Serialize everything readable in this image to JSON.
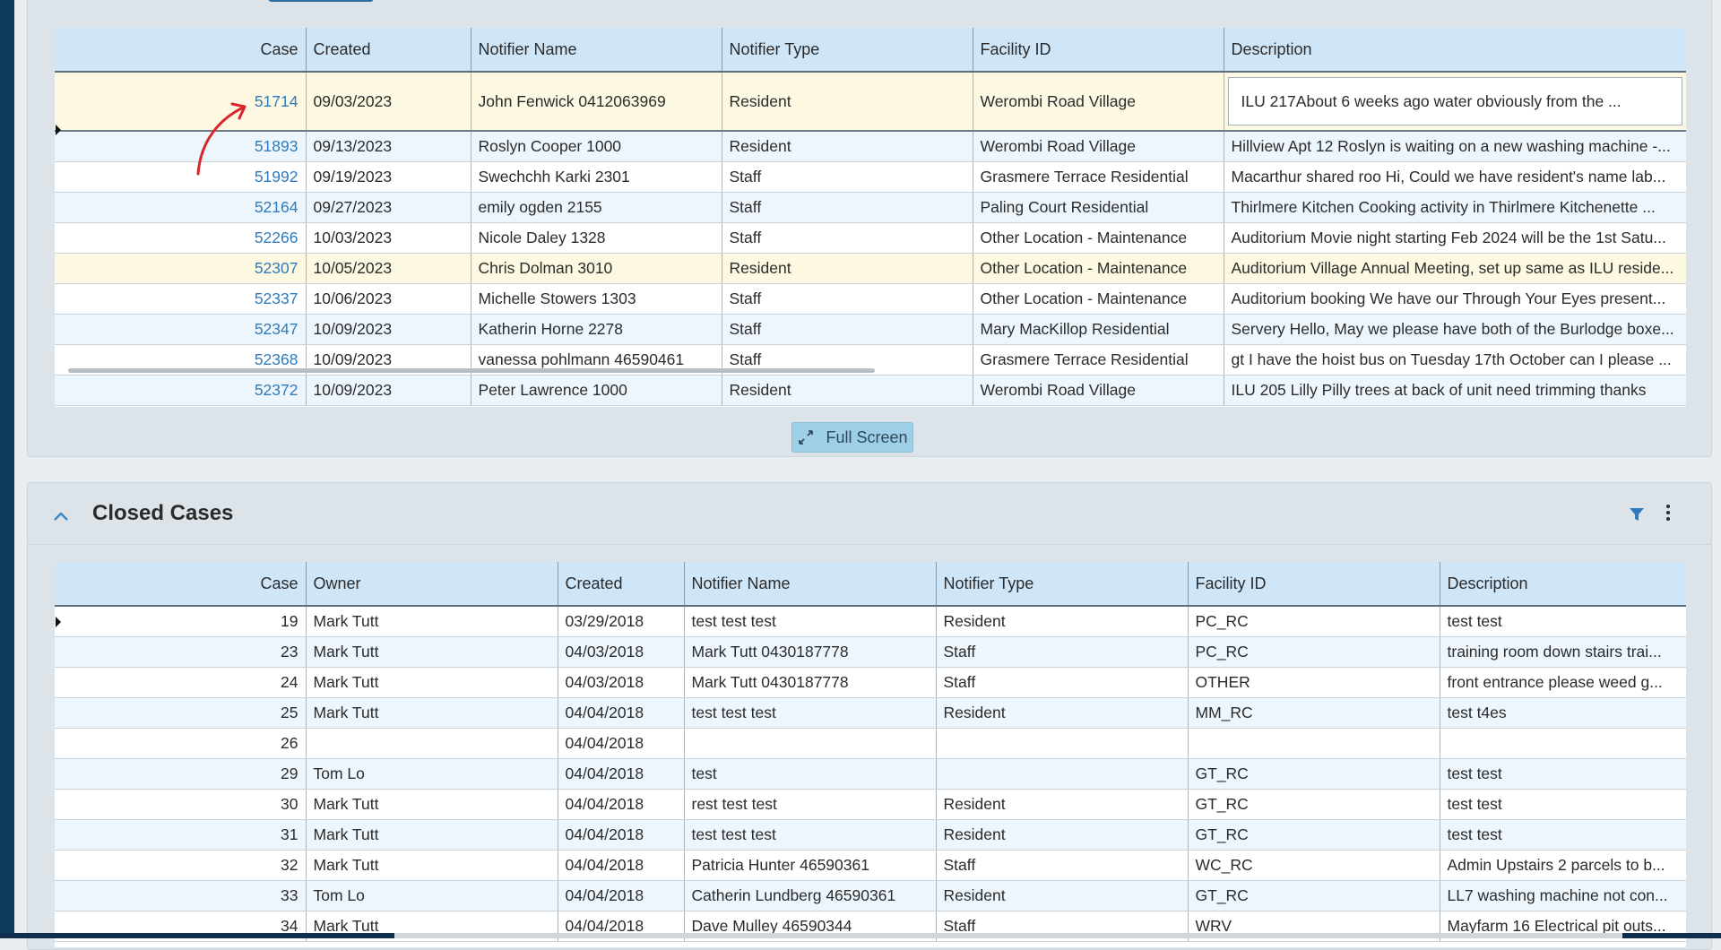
{
  "open_cases": {
    "columns": [
      "Case",
      "Created",
      "Notifier Name",
      "Notifier Type",
      "Facility ID",
      "Description"
    ],
    "rows": [
      {
        "case": "51714",
        "created": "09/03/2023",
        "notifier_name": "John Fenwick 0412063969",
        "notifier_type": "Resident",
        "facility": "Werombi Road Village",
        "description": "ILU 217About 6 weeks ago water obviously from the ..."
      },
      {
        "case": "51893",
        "created": "09/13/2023",
        "notifier_name": "Roslyn Cooper 1000",
        "notifier_type": "Resident",
        "facility": "Werombi Road Village",
        "description": "Hillview Apt 12 Roslyn is waiting on a new washing machine -..."
      },
      {
        "case": "51992",
        "created": "09/19/2023",
        "notifier_name": "Swechchh Karki 2301",
        "notifier_type": "Staff",
        "facility": "Grasmere Terrace Residential",
        "description": "Macarthur shared roo Hi, Could we have resident's name lab..."
      },
      {
        "case": "52164",
        "created": "09/27/2023",
        "notifier_name": "emily ogden 2155",
        "notifier_type": "Staff",
        "facility": "Paling Court Residential",
        "description": "Thirlmere Kitchen Cooking activity in Thirlmere Kitchenette ..."
      },
      {
        "case": "52266",
        "created": "10/03/2023",
        "notifier_name": "Nicole Daley 1328",
        "notifier_type": "Staff",
        "facility": "Other Location - Maintenance",
        "description": "Auditorium Movie night starting Feb 2024 will be the 1st Satu..."
      },
      {
        "case": "52307",
        "created": "10/05/2023",
        "notifier_name": "Chris Dolman 3010",
        "notifier_type": "Resident",
        "facility": "Other Location - Maintenance",
        "description": "Auditorium Village Annual Meeting, set up same as ILU reside..."
      },
      {
        "case": "52337",
        "created": "10/06/2023",
        "notifier_name": "Michelle Stowers 1303",
        "notifier_type": "Staff",
        "facility": "Other Location - Maintenance",
        "description": "Auditorium booking We have our Through Your Eyes present..."
      },
      {
        "case": "52347",
        "created": "10/09/2023",
        "notifier_name": "Katherin Horne 2278",
        "notifier_type": "Staff",
        "facility": "Mary MacKillop Residential",
        "description": "Servery Hello, May we please have both of the Burlodge boxe..."
      },
      {
        "case": "52368",
        "created": "10/09/2023",
        "notifier_name": "vanessa pohlmann 46590461",
        "notifier_type": "Staff",
        "facility": "Grasmere Terrace Residential",
        "description": "gt I have the hoist bus on Tuesday 17th October can I please ..."
      },
      {
        "case": "52372",
        "created": "10/09/2023",
        "notifier_name": "Peter Lawrence 1000",
        "notifier_type": "Resident",
        "facility": "Werombi Road Village",
        "description": "ILU 205 Lilly Pilly trees at back of unit need trimming thanks"
      }
    ]
  },
  "fullscreen_label": "Full Screen",
  "closed_cases": {
    "title": "Closed Cases",
    "columns": [
      "Case",
      "Owner",
      "Created",
      "Notifier Name",
      "Notifier Type",
      "Facility ID",
      "Description"
    ],
    "rows": [
      {
        "case": "19",
        "owner": "Mark Tutt",
        "created": "03/29/2018",
        "notifier_name": "test test test",
        "notifier_type": "Resident",
        "facility": "PC_RC",
        "description": "test test"
      },
      {
        "case": "23",
        "owner": "Mark Tutt",
        "created": "04/03/2018",
        "notifier_name": "Mark Tutt 0430187778",
        "notifier_type": "Staff",
        "facility": "PC_RC",
        "description": "training room down stairs trai..."
      },
      {
        "case": "24",
        "owner": "Mark Tutt",
        "created": "04/03/2018",
        "notifier_name": "Mark Tutt 0430187778",
        "notifier_type": "Staff",
        "facility": "OTHER",
        "description": "front entrance please weed g..."
      },
      {
        "case": "25",
        "owner": "Mark Tutt",
        "created": "04/04/2018",
        "notifier_name": "test test test",
        "notifier_type": "Resident",
        "facility": "MM_RC",
        "description": "test t4es"
      },
      {
        "case": "26",
        "owner": "",
        "created": "04/04/2018",
        "notifier_name": "",
        "notifier_type": "",
        "facility": "",
        "description": ""
      },
      {
        "case": "29",
        "owner": "Tom Lo",
        "created": "04/04/2018",
        "notifier_name": "test",
        "notifier_type": "",
        "facility": "GT_RC",
        "description": "test test"
      },
      {
        "case": "30",
        "owner": "Mark Tutt",
        "created": "04/04/2018",
        "notifier_name": "rest test test",
        "notifier_type": "Resident",
        "facility": "GT_RC",
        "description": "test test"
      },
      {
        "case": "31",
        "owner": "Mark Tutt",
        "created": "04/04/2018",
        "notifier_name": "test test test",
        "notifier_type": "Resident",
        "facility": "GT_RC",
        "description": "test test"
      },
      {
        "case": "32",
        "owner": "Mark Tutt",
        "created": "04/04/2018",
        "notifier_name": "Patricia Hunter 46590361",
        "notifier_type": "Staff",
        "facility": "WC_RC",
        "description": "Admin Upstairs 2 parcels to b..."
      },
      {
        "case": "33",
        "owner": "Tom Lo",
        "created": "04/04/2018",
        "notifier_name": "Catherin Lundberg 46590361",
        "notifier_type": "Resident",
        "facility": "GT_RC",
        "description": "LL7 washing machine not con..."
      },
      {
        "case": "34",
        "owner": "Mark Tutt",
        "created": "04/04/2018",
        "notifier_name": "Dave Mulley 46590344",
        "notifier_type": "Staff",
        "facility": "WRV",
        "description": "Mayfarm 16 Electrical pit outs..."
      }
    ]
  },
  "icons": {
    "collapse": "chevron-up-icon",
    "filter": "filter-icon",
    "menu": "more-vertical-icon",
    "fullscreen": "expand-icon"
  },
  "colors": {
    "header_bg": "#cfe6f8",
    "link": "#2e7bbd",
    "highlight_row": "#fdf8e1",
    "accent": "#3a88c2"
  }
}
